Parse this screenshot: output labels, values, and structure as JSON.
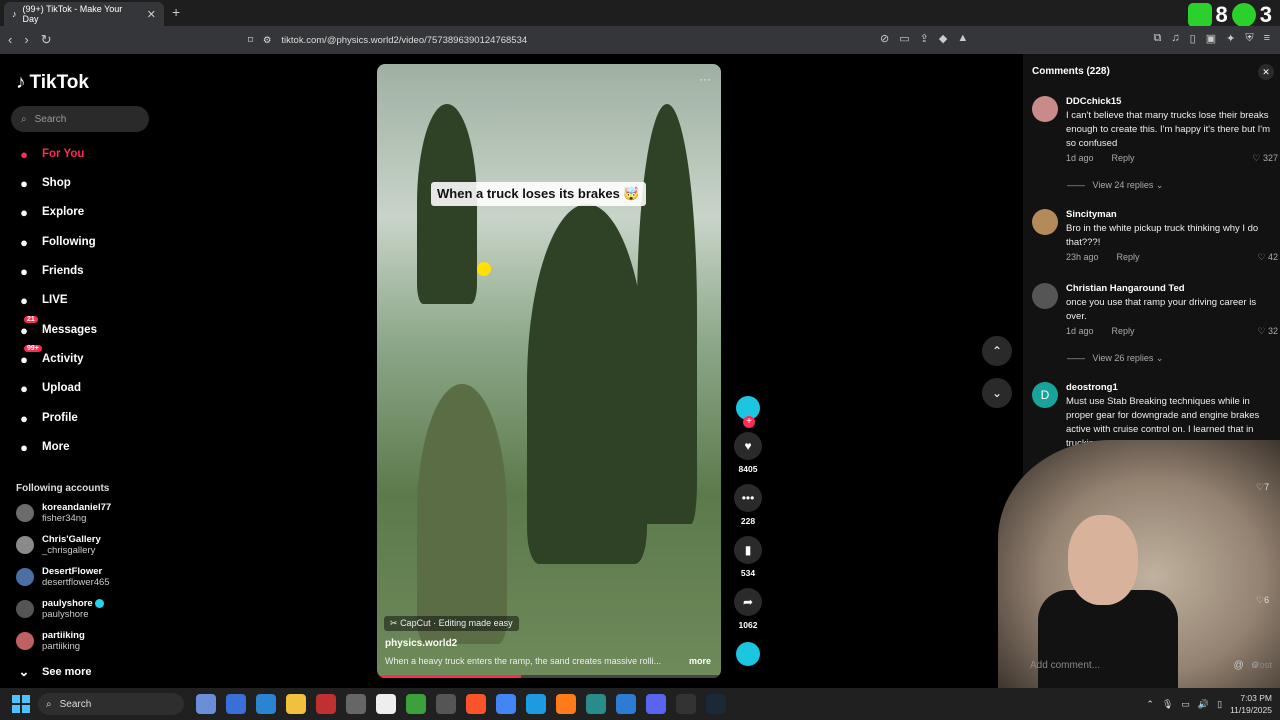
{
  "browser": {
    "tab_title": "(99+) TikTok - Make Your Day",
    "url": "tiktok.com/@physics.world2/video/7573896390124768534",
    "ext_badge_1": "8",
    "ext_badge_2": "3"
  },
  "sidebar": {
    "logo": "TikTok",
    "search_placeholder": "Search",
    "nav": [
      {
        "label": "For You",
        "icon": "home-icon"
      },
      {
        "label": "Shop",
        "icon": "shop-icon"
      },
      {
        "label": "Explore",
        "icon": "compass-icon"
      },
      {
        "label": "Following",
        "icon": "following-avatar-icon"
      },
      {
        "label": "Friends",
        "icon": "friends-icon"
      },
      {
        "label": "LIVE",
        "icon": "live-icon"
      },
      {
        "label": "Messages",
        "icon": "messages-icon",
        "badge": "21"
      },
      {
        "label": "Activity",
        "icon": "activity-icon",
        "badge": "99+"
      },
      {
        "label": "Upload",
        "icon": "upload-icon"
      },
      {
        "label": "Profile",
        "icon": "profile-icon"
      },
      {
        "label": "More",
        "icon": "more-icon"
      }
    ],
    "following_title": "Following accounts",
    "accounts": [
      {
        "name": "koreandaniel77",
        "handle": "fisher34ng"
      },
      {
        "name": "Chris'Gallery",
        "handle": "_chrisgallery"
      },
      {
        "name": "DesertFlower",
        "handle": "desertflower465"
      },
      {
        "name": "paulyshore",
        "handle": "paulyshore",
        "verified": true
      },
      {
        "name": "partiiking",
        "handle": "partiiking"
      }
    ],
    "see_more": "See more"
  },
  "video": {
    "overlay_text": "When a truck loses its brakes 🤯",
    "capcut_label": "CapCut · Editing made easy",
    "author": "physics.world2",
    "description": "When a heavy truck enters the ramp, the sand creates massive rolli...",
    "more_label": "more",
    "progress": 0.42
  },
  "actions": {
    "likes": "8405",
    "comments": "228",
    "saves": "534",
    "shares": "1062"
  },
  "comments": {
    "title": "Comments (228)",
    "items": [
      {
        "user": "DDCchick15",
        "text": "I can't believe that many trucks lose their breaks enough to create this. I'm happy it's there but I'm so confused",
        "time": "1d ago",
        "reply": "Reply",
        "likes": "327",
        "view_replies": "View 24 replies"
      },
      {
        "user": "Sincityman",
        "text": "Bro in the white pickup truck thinking why I do that???!",
        "time": "23h ago",
        "reply": "Reply",
        "likes": "42"
      },
      {
        "user": "Christian Hangaround Ted",
        "text": "once you use that ramp your driving career is over.",
        "time": "1d ago",
        "reply": "Reply",
        "likes": "32",
        "view_replies": "View 26 replies"
      },
      {
        "user": "deostrong1",
        "text": "Must use Stab Breaking techniques while in proper gear for downgrade and engine brakes active with cruise control on. I learned that in trucking",
        "time": "",
        "reply": "",
        "likes": "7"
      }
    ],
    "add_comment_placeholder": "Add comment...",
    "post_label": "Post",
    "extra_like": "6"
  },
  "taskbar": {
    "search_label": "Search",
    "time": "7:03 PM",
    "date": "11/19/2025"
  }
}
